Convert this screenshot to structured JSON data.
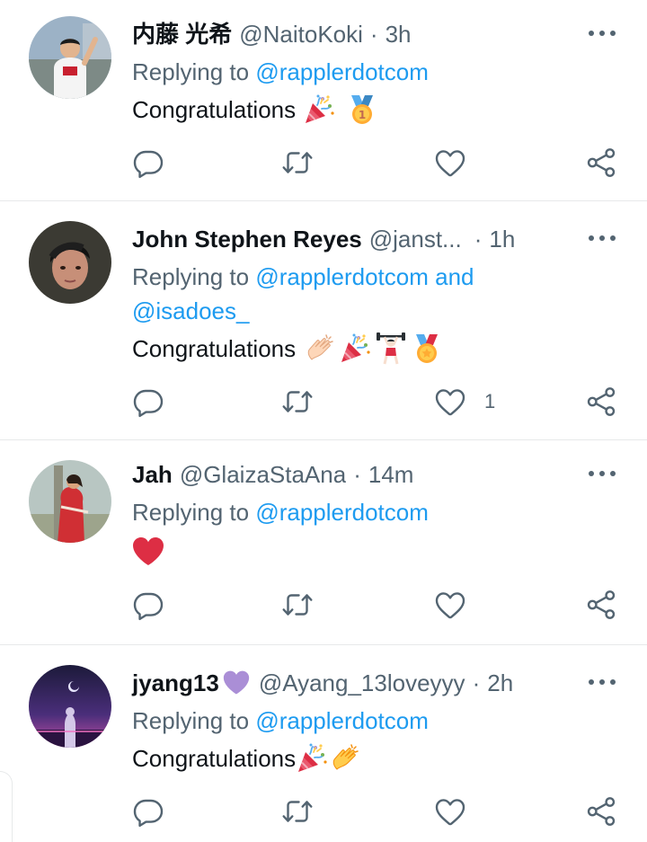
{
  "colors": {
    "accent": "#1d9bf0",
    "secondary_text": "#536471",
    "divider": "#e7e9ea",
    "primary_text": "#0f1419"
  },
  "tweets": [
    {
      "name": "内藤 光希",
      "handle": "@NaitoKoki",
      "dot": "·",
      "time": "3h",
      "replying_prefix": "Replying to",
      "mentions": [
        "@rapplerdotcom"
      ],
      "text": "Congratulations",
      "emojis": [
        "party-popper",
        "first-place-medal"
      ],
      "like_count": ""
    },
    {
      "name": "John Stephen Reyes",
      "handle": "@janst...",
      "dot": "·",
      "time": "1h",
      "replying_prefix": "Replying to",
      "mentions": [
        "@rapplerdotcom",
        "@isadoes_"
      ],
      "mention_joiner": "and",
      "text": "Congratulations",
      "emojis": [
        "clapping-hands",
        "party-popper",
        "weightlifter",
        "sports-medal"
      ],
      "like_count": "1"
    },
    {
      "name": "Jah",
      "handle": "@GlaizaStaAna",
      "dot": "·",
      "time": "14m",
      "replying_prefix": "Replying to",
      "mentions": [
        "@rapplerdotcom"
      ],
      "text": "",
      "emojis": [
        "red-heart"
      ],
      "like_count": ""
    },
    {
      "name": "jyang13",
      "name_badge": "purple-heart",
      "handle": "@Ayang_13loveyyy",
      "dot": "·",
      "time": "2h",
      "replying_prefix": "Replying to",
      "mentions": [
        "@rapplerdotcom"
      ],
      "text": "Congratulations",
      "emojis": [
        "party-popper",
        "clapping-hands"
      ],
      "like_count": ""
    }
  ]
}
